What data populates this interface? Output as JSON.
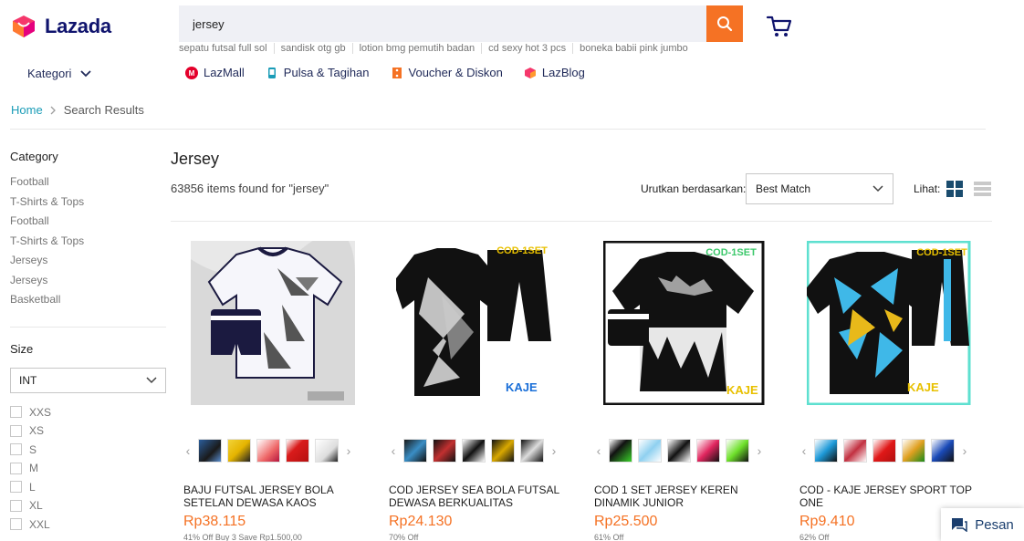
{
  "brand": {
    "name": "Lazada"
  },
  "search": {
    "value": "jersey"
  },
  "suggestions": [
    "sepatu futsal full sol",
    "sandisk otg gb",
    "lotion bmg pemutih badan",
    "cd sexy hot 3 pcs",
    "boneka babii pink jumbo"
  ],
  "nav": {
    "kategori": "Kategori",
    "links": [
      {
        "label": "LazMall",
        "icon": "lazmall-icon",
        "color": "#e4002b"
      },
      {
        "label": "Pulsa & Tagihan",
        "icon": "phone-icon",
        "color": "#1a9cb7"
      },
      {
        "label": "Voucher & Diskon",
        "icon": "voucher-icon",
        "color": "#f57224"
      },
      {
        "label": "LazBlog",
        "icon": "lazblog-icon",
        "color": "#d81b60"
      }
    ]
  },
  "breadcrumb": {
    "home": "Home",
    "current": "Search Results"
  },
  "sidebar": {
    "category_title": "Category",
    "categories": [
      "Football",
      "T-Shirts & Tops",
      "Football",
      "T-Shirts & Tops",
      "Jerseys",
      "Jerseys",
      "Basketball"
    ],
    "size_title": "Size",
    "size_select": "INT",
    "sizes": [
      "XXS",
      "XS",
      "S",
      "M",
      "L",
      "XL",
      "XXL"
    ]
  },
  "main": {
    "title": "Jersey",
    "items_found": "63856 items found for \"jersey\"",
    "sort_label": "Urutkan berdasarkan:",
    "sort_value": "Best Match",
    "view_label": "Lihat:"
  },
  "products": [
    {
      "name": "BAJU FUTSAL JERSEY BOLA SETELAN DEWASA KAOS OLAHRAG...",
      "price": "Rp38.115",
      "discount": "41% Off   Buy 3 Save Rp1.500,00",
      "badge": ""
    },
    {
      "name": "COD JERSEY SEA BOLA FUTSAL DEWASA BERKUALITAS",
      "price": "Rp24.130",
      "discount": "70% Off",
      "badge": "COD-1SET"
    },
    {
      "name": "COD 1 SET JERSEY KEREN DINAMIK JUNIOR",
      "price": "Rp25.500",
      "discount": "61% Off",
      "badge": "COD-1SET"
    },
    {
      "name": "COD - KAJE JERSEY SPORT TOP ONE",
      "price": "Rp9.410",
      "discount": "62% Off",
      "badge": "COD-1SET"
    }
  ],
  "chat": {
    "label": "Pesan"
  },
  "colors": {
    "accent": "#f57224",
    "link": "#1a9cb7",
    "navy": "#0f136d"
  }
}
